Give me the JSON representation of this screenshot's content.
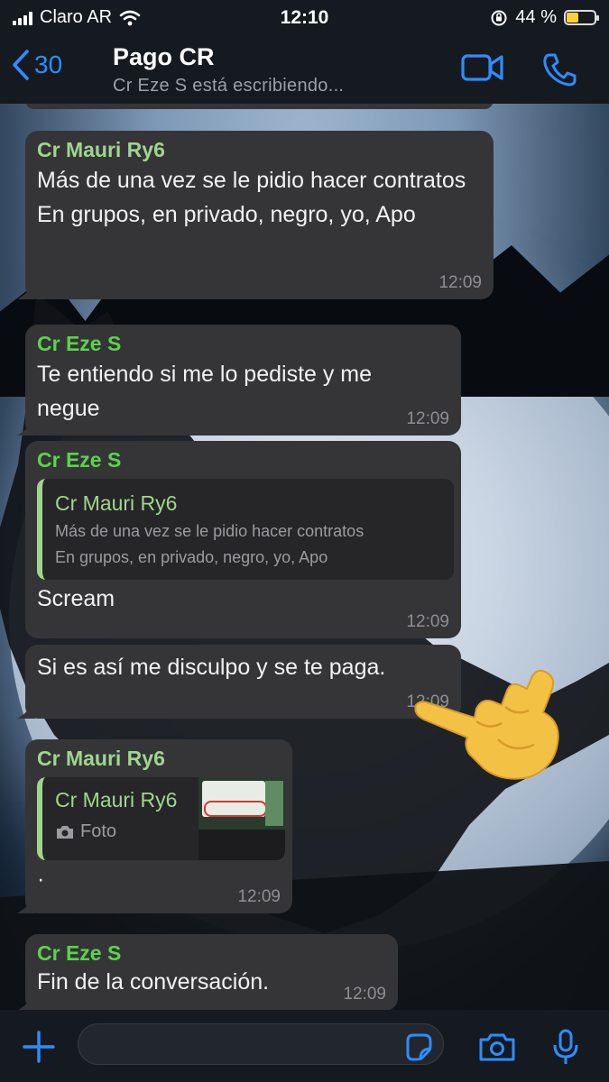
{
  "status_bar": {
    "carrier": "Claro AR",
    "time": "12:10",
    "battery_percent": "44 %",
    "battery_level": 0.44
  },
  "header": {
    "back_count": "30",
    "title": "Pago CR",
    "subtitle": "Cr Eze S está escribiendo..."
  },
  "messages": [
    {
      "sender": "Cr Mauri Ry6",
      "text": "Más de una vez se le pidio hacer contratos\nEn grupos, en privado, negro, yo, Apo",
      "time": "12:09"
    },
    {
      "sender": "Cr Eze S",
      "text": "Te entiendo si me lo pediste y me negue",
      "time": "12:09"
    },
    {
      "sender": "Cr Eze S",
      "quote": {
        "name": "Cr Mauri Ry6",
        "text": "Más de una vez se le pidio hacer contratos\nEn grupos, en privado, negro, yo, Apo"
      },
      "text": "Scream",
      "time": "12:09"
    },
    {
      "text": "Si es así me disculpo y se te paga.",
      "time": "12:09"
    },
    {
      "sender": "Cr Mauri Ry6",
      "quote": {
        "name": "Cr Mauri Ry6",
        "media_label": "Foto"
      },
      "text": "·",
      "time": "12:09"
    },
    {
      "sender": "Cr Eze S",
      "text": "Fin de la conversación.",
      "time": "12:09"
    }
  ],
  "composer": {
    "value": "",
    "placeholder": ""
  },
  "colors": {
    "accent": "#2f8cff",
    "bubble": "#353538",
    "sender_mauri": "#9fd68e",
    "sender_eze": "#5bd44a"
  },
  "icons": [
    "signal-icon",
    "wifi-icon",
    "orientation-lock-icon",
    "battery-icon",
    "back-chevron-icon",
    "video-call-icon",
    "phone-call-icon",
    "camera-icon",
    "plus-icon",
    "sticker-icon",
    "microphone-icon",
    "horns-hand-emoji"
  ]
}
